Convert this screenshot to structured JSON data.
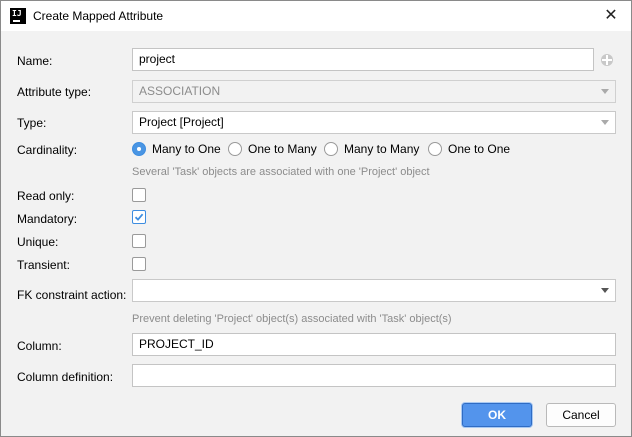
{
  "window": {
    "title": "Create Mapped Attribute",
    "close_icon": "close-icon",
    "app_icon": "intellij-icon"
  },
  "form": {
    "name": {
      "label": "Name:",
      "value": "project"
    },
    "attribute_type": {
      "label": "Attribute type:",
      "value": "ASSOCIATION"
    },
    "type": {
      "label": "Type:",
      "value": "Project [Project]"
    },
    "cardinality": {
      "label": "Cardinality:",
      "options": [
        "Many to One",
        "One to Many",
        "Many to Many",
        "One to One"
      ],
      "selected": "Many to One",
      "hint": "Several 'Task' objects are associated with one 'Project' object"
    },
    "read_only": {
      "label": "Read only:",
      "checked": false
    },
    "mandatory": {
      "label": "Mandatory:",
      "checked": true
    },
    "unique": {
      "label": "Unique:",
      "checked": false
    },
    "transient": {
      "label": "Transient:",
      "checked": false
    },
    "fk_constraint": {
      "label": "FK constraint action:",
      "value": "",
      "hint": "Prevent deleting 'Project' object(s) associated with 'Task' object(s)"
    },
    "column": {
      "label": "Column:",
      "value": "PROJECT_ID"
    },
    "column_definition": {
      "label": "Column definition:",
      "value": ""
    }
  },
  "buttons": {
    "ok": "OK",
    "cancel": "Cancel"
  },
  "colors": {
    "accent": "#4a95e3",
    "ok_button": "#5394ec",
    "hint_text": "#8c8c8c"
  }
}
